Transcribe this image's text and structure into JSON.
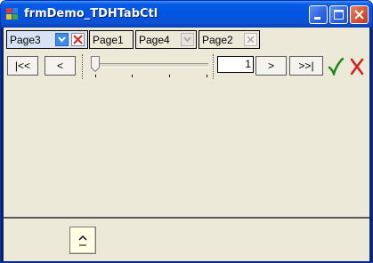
{
  "window": {
    "title": "frmDemo_TDHTabCtl",
    "icon": "app-window-icon",
    "controls": [
      "minimize-icon",
      "maximize-icon",
      "close-icon"
    ]
  },
  "tabs": [
    {
      "label": "Page3",
      "active": true,
      "icons": [
        "dropdown-arrow-icon",
        "close-icon"
      ]
    },
    {
      "label": "Page1",
      "active": false,
      "icons": []
    },
    {
      "label": "Page4",
      "active": false,
      "icons": [
        "dropdown-arrow-icon"
      ]
    },
    {
      "label": "Page2",
      "active": false,
      "icons": [
        "close-icon"
      ]
    }
  ],
  "toolbar": {
    "first_label": "|<<",
    "prev_label": "<",
    "position_value": "1",
    "next_label": ">",
    "last_label": ">>|",
    "ok_icon": "checkmark-icon",
    "cancel_icon": "x-icon"
  },
  "bottom": {
    "up_button_label": "^",
    "up_button_icon": "caret-up-icon"
  },
  "colors": {
    "titlebar": "#0054e3",
    "face": "#ece9d8",
    "active_tab": "#d7e3f5",
    "ok_green": "#1a8a1a",
    "cancel_red": "#d02020",
    "up_button": "#ffffe6"
  }
}
